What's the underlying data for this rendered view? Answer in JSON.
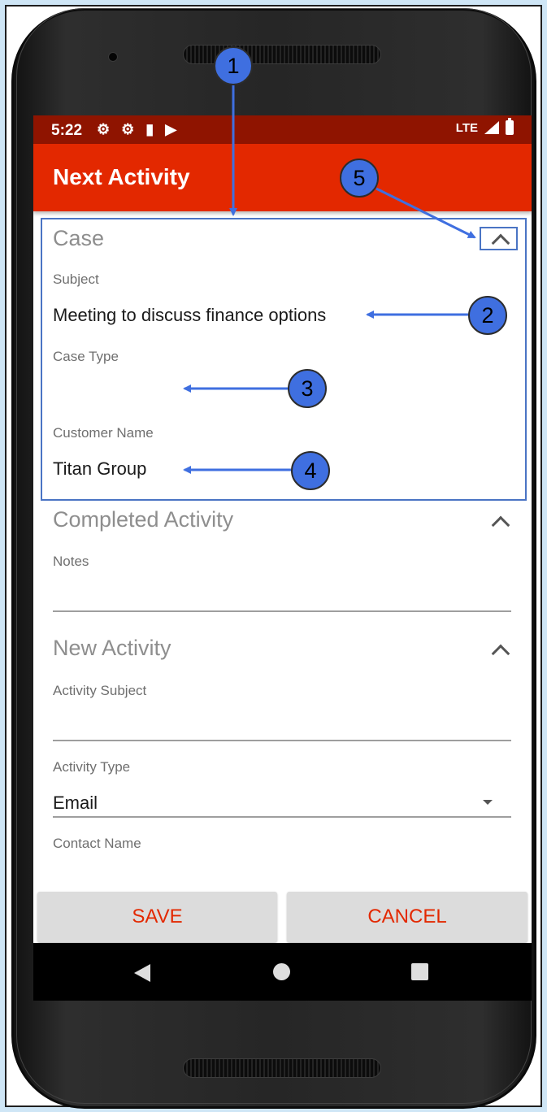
{
  "status_bar": {
    "time": "5:22",
    "network": "LTE",
    "icons": [
      "gear-icon",
      "gear-icon",
      "sd-card-icon",
      "play-store-icon"
    ]
  },
  "app_bar": {
    "title": "Next Activity"
  },
  "case_section": {
    "title": "Case",
    "subject_label": "Subject",
    "subject_value": "Meeting to discuss finance options",
    "case_type_label": "Case Type",
    "case_type_value": "",
    "customer_name_label": "Customer Name",
    "customer_name_value": "Titan Group"
  },
  "completed_activity_section": {
    "title": "Completed Activity",
    "notes_label": "Notes",
    "notes_value": ""
  },
  "new_activity_section": {
    "title": "New Activity",
    "activity_subject_label": "Activity Subject",
    "activity_subject_value": "",
    "activity_type_label": "Activity Type",
    "activity_type_value": "Email",
    "contact_name_label": "Contact Name"
  },
  "buttons": {
    "save": "SAVE",
    "cancel": "CANCEL"
  },
  "annotations": {
    "callouts": [
      "1",
      "2",
      "3",
      "4",
      "5"
    ],
    "color": "#4a74c4"
  },
  "colors": {
    "app_bar": "#e32800",
    "status_bar": "#8f1400",
    "button_text": "#e32800"
  }
}
